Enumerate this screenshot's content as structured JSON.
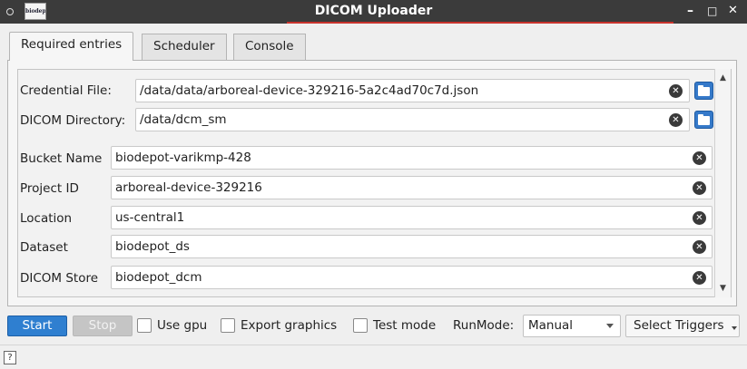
{
  "window": {
    "title": "DICOM Uploader",
    "logo_text": "biodepot",
    "minimize": "–",
    "maximize": "□",
    "close": "✕"
  },
  "tabs": [
    {
      "label": "Required entries",
      "active": true
    },
    {
      "label": "Scheduler",
      "active": false
    },
    {
      "label": "Console",
      "active": false
    }
  ],
  "form": {
    "credential_file": {
      "label": "Credential File:",
      "value": "/data/data/arboreal-device-329216-5a2c4ad70c7d.json"
    },
    "dicom_directory": {
      "label": "DICOM Directory:",
      "value": "/data/dcm_sm"
    },
    "bucket_name": {
      "label": "Bucket Name",
      "value": "biodepot-varikmp-428"
    },
    "project_id": {
      "label": "Project ID",
      "value": "arboreal-device-329216"
    },
    "location": {
      "label": "Location",
      "value": "us-central1"
    },
    "dataset": {
      "label": "Dataset",
      "value": "biodepot_ds"
    },
    "dicom_store": {
      "label": "DICOM Store",
      "value": "biodepot_dcm"
    }
  },
  "icons": {
    "clear": "✕",
    "scroll_up": "▲",
    "scroll_down": "▼",
    "help": "?"
  },
  "toolbar": {
    "start_label": "Start",
    "stop_label": "Stop",
    "use_gpu_label": "Use gpu",
    "export_graphics_label": "Export graphics",
    "test_mode_label": "Test mode",
    "runmode_label": "RunMode:",
    "runmode_value": "Manual",
    "select_triggers_label": "Select Triggers"
  },
  "colors": {
    "accent": "#c8332c",
    "start_button": "#2f7fd0",
    "folder_icon": "#3579c9"
  }
}
